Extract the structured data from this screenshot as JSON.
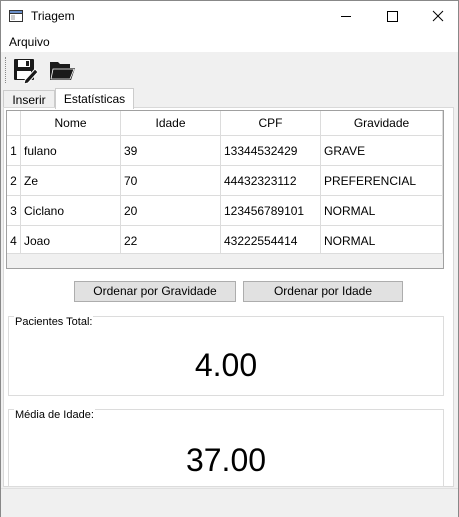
{
  "window": {
    "title": "Triagem"
  },
  "menu": {
    "file": "Arquivo"
  },
  "tabs": [
    {
      "label": "Inserir"
    },
    {
      "label": "Estatísticas"
    }
  ],
  "table": {
    "columns": [
      "Nome",
      "Idade",
      "CPF",
      "Gravidade"
    ],
    "rows": [
      {
        "num": "1",
        "nome": "fulano",
        "idade": "39",
        "cpf": "13344532429",
        "gravidade": "GRAVE"
      },
      {
        "num": "2",
        "nome": "Ze",
        "idade": "70",
        "cpf": "44432323112",
        "gravidade": "PREFERENCIAL"
      },
      {
        "num": "3",
        "nome": "Ciclano",
        "idade": "20",
        "cpf": "123456789101",
        "gravidade": "NORMAL"
      },
      {
        "num": "4",
        "nome": "Joao",
        "idade": "22",
        "cpf": "43222554414",
        "gravidade": "NORMAL"
      }
    ]
  },
  "buttons": {
    "sort_gravity": "Ordenar por Gravidade",
    "sort_age": "Ordenar por Idade"
  },
  "stats": {
    "total_label": "Pacientes Total:",
    "total_value": "4.00",
    "avg_label": "Média de Idade:",
    "avg_value": "37.00"
  }
}
